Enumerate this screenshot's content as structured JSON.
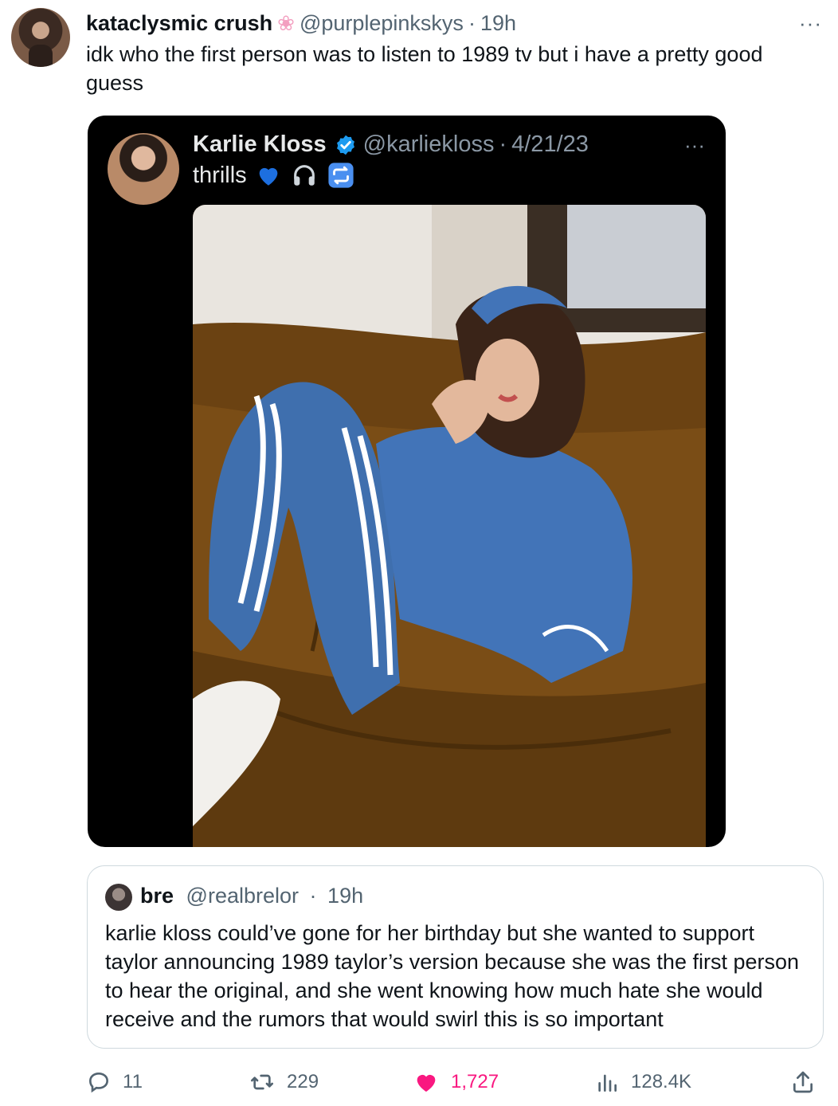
{
  "tweet": {
    "display_name": "kataclysmic crush",
    "name_emoji": "❀",
    "handle": "@purplepinkskys",
    "separator": "·",
    "time": "19h",
    "text": "idk who the first person was to listen to 1989 tv but i have a pretty good guess",
    "more_icon": "···"
  },
  "embedded": {
    "display_name": "Karlie Kloss",
    "handle": "@karliekloss",
    "separator": "·",
    "date": "4/21/23",
    "text": "thrills",
    "emojis": [
      "blue-heart-icon",
      "headphones-icon",
      "repeat-icon"
    ],
    "more_icon": "···"
  },
  "quote": {
    "display_name": "bre",
    "handle": "@realbrelor",
    "separator": "·",
    "time": "19h",
    "text": "karlie kloss could’ve gone for her birthday but she wanted to support taylor announcing 1989 taylor’s version because she was the first person to hear the original, and she went knowing how much hate she would receive and the rumors that would swirl this is so important"
  },
  "actions": {
    "replies": "11",
    "reposts": "229",
    "likes": "1,727",
    "views": "128.4K"
  },
  "colors": {
    "like_active": "#f91880",
    "muted": "#536471",
    "verified": "#1d9bf0"
  }
}
